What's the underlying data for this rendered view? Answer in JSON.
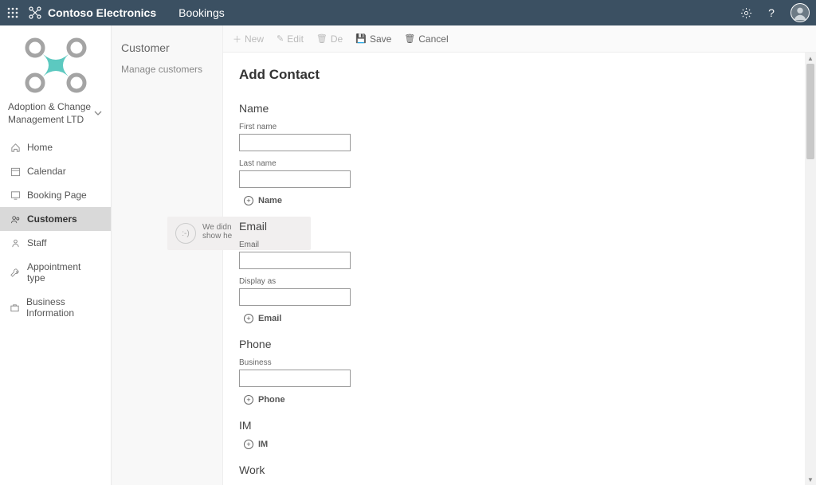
{
  "topbar": {
    "brand": "Contoso Electronics",
    "app": "Bookings"
  },
  "nav": {
    "business_name": "Adoption & Change Management LTD",
    "items": [
      {
        "icon": "home",
        "label": "Home"
      },
      {
        "icon": "calendar",
        "label": "Calendar"
      },
      {
        "icon": "monitor",
        "label": "Booking Page"
      },
      {
        "icon": "people",
        "label": "Customers"
      },
      {
        "icon": "person-run",
        "label": "Staff"
      },
      {
        "icon": "wrench",
        "label": "Appointment type"
      },
      {
        "icon": "briefcase",
        "label": "Business Information"
      }
    ],
    "active_index": 3
  },
  "column2": {
    "header": "Customer",
    "subheader": "Manage customers",
    "placeholder_line1": "We didn",
    "placeholder_line2": "show he",
    "placeholder_face": ":-)"
  },
  "toolbar": {
    "new": "New",
    "edit": "Edit",
    "delete": "De",
    "save": "Save",
    "cancel": "Cancel"
  },
  "panel": {
    "title": "Add Contact",
    "sections": {
      "name": {
        "title": "Name",
        "first_label": "First name",
        "last_label": "Last name",
        "add_label": "Name"
      },
      "email": {
        "title": "Email",
        "email_label": "Email",
        "display_as_label": "Display as",
        "add_label": "Email"
      },
      "phone": {
        "title": "Phone",
        "business_label": "Business",
        "add_label": "Phone"
      },
      "im": {
        "title": "IM",
        "add_label": "IM"
      },
      "work": {
        "title": "Work"
      }
    }
  }
}
